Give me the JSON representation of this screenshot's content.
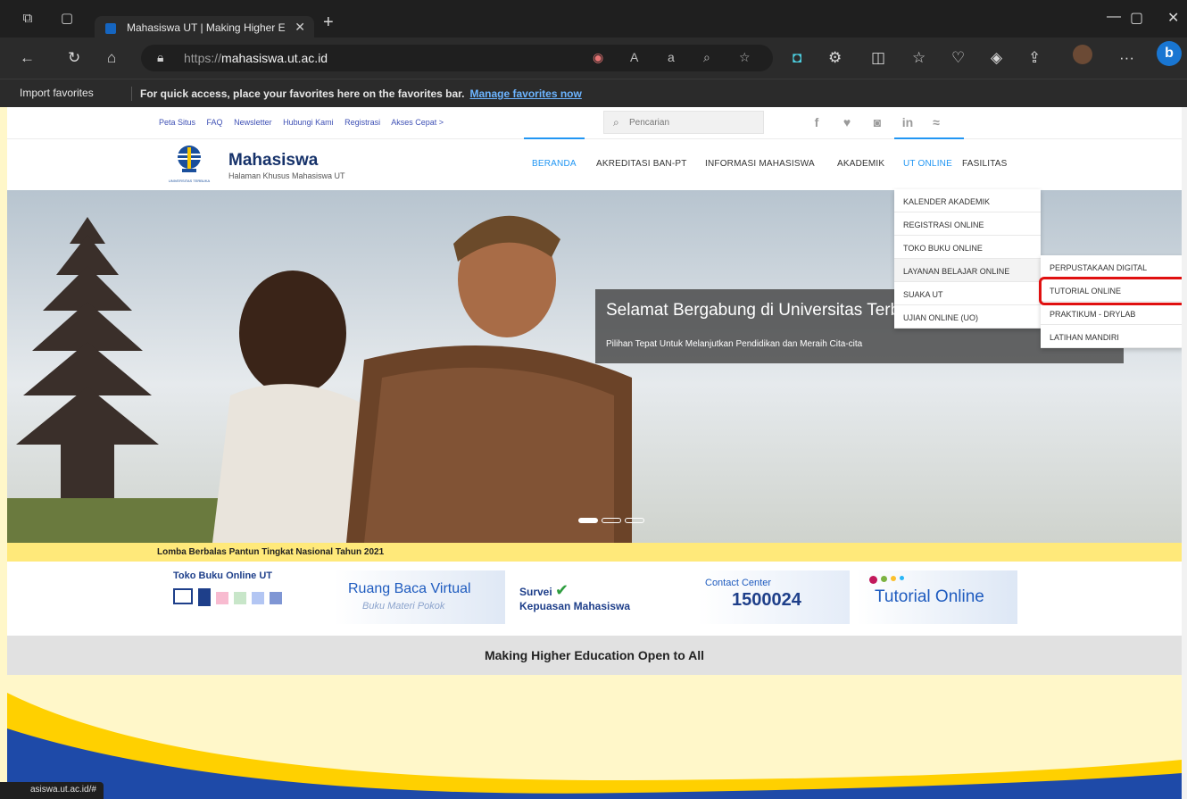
{
  "browser": {
    "tab_title": "Mahasiswa UT | Making Higher E",
    "url_prefix": "https://",
    "url_domain": "mahasiswa.ut.ac.id",
    "favbar_import": "Import favorites",
    "favbar_message": "For quick access, place your favorites here on the favorites bar.",
    "favbar_link": "Manage favorites now",
    "status_url": "asiswa.ut.ac.id/#"
  },
  "site": {
    "top_links": [
      "Peta Situs",
      "FAQ",
      "Newsletter",
      "Hubungi Kami",
      "Registrasi",
      "Akses Cepat >"
    ],
    "search_placeholder": "Pencarian",
    "brand": "Mahasiswa",
    "brand_sub": "Halaman Khusus Mahasiswa UT",
    "logo_caption": "UNIVERSITAS TERBUKA",
    "menu": [
      "BERANDA",
      "AKREDITASI BAN-PT",
      "INFORMASI MAHASISWA",
      "AKADEMIK",
      "UT ONLINE",
      "FASILITAS"
    ],
    "dropdown": [
      "KALENDER AKADEMIK",
      "REGISTRASI ONLINE",
      "TOKO BUKU ONLINE",
      "LAYANAN BELAJAR ONLINE",
      "SUAKA UT",
      "UJIAN ONLINE (UO)"
    ],
    "subdropdown": [
      "PERPUSTAKAAN DIGITAL",
      "TUTORIAL ONLINE",
      "PRAKTIKUM - DRYLAB",
      "LATIHAN MANDIRI"
    ],
    "hero_title": "Selamat Bergabung di Universitas Terbuka",
    "hero_subtitle": "Pilihan Tepat Untuk Melanjutkan Pendidikan dan Meraih Cita-cita",
    "news": "Lomba Berbalas Pantun Tingkat Nasional Tahun 2021",
    "banners": {
      "toko": "Toko Buku Online UT",
      "ruang_title": "Ruang Baca Virtual",
      "ruang_sub": "Buku Materi Pokok",
      "survei_1": "Survei",
      "survei_2": "Kepuasan Mahasiswa",
      "contact_title": "Contact Center",
      "contact_number": "1500024",
      "tutorial": "Tutorial Online"
    },
    "tagline": "Making Higher Education Open to All"
  },
  "colors": {
    "accent": "#2196f3",
    "brand": "#16326a",
    "highlight": "#e01010",
    "news_bg": "#ffe97a"
  }
}
